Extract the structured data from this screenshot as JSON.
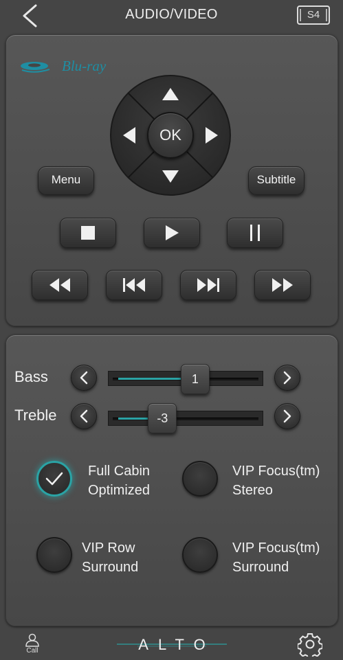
{
  "header": {
    "title": "AUDIO/VIDEO",
    "seat_badge": "S4",
    "back_icon": "chevron-left-icon"
  },
  "bluray": {
    "logo_text": "Blu-ray",
    "accent_color": "#1e8ea3"
  },
  "dpad": {
    "ok_label": "OK"
  },
  "buttons": {
    "menu_label": "Menu",
    "subtitle_label": "Subtitle"
  },
  "transport": {
    "row1": [
      "stop-icon",
      "play-icon",
      "pause-icon"
    ],
    "row2": [
      "rewind-icon",
      "previous-track-icon",
      "next-track-icon",
      "fast-forward-icon"
    ]
  },
  "audio": {
    "bass": {
      "label": "Bass",
      "value": "1",
      "level": 0.57
    },
    "treble": {
      "label": "Treble",
      "value": "-3",
      "level": 0.33
    },
    "accent_color": "#2aa3a5"
  },
  "modes": [
    {
      "line1": "Full Cabin",
      "line2": "Optimized",
      "selected": true
    },
    {
      "line1": "VIP Focus(tm)",
      "line2": "Stereo",
      "selected": false
    },
    {
      "line1": "VIP Row",
      "line2": "Surround",
      "selected": false
    },
    {
      "line1": "VIP Focus(tm)",
      "line2": "Surround",
      "selected": false
    }
  ],
  "footer": {
    "call_label": "Call",
    "brand": "ALTO",
    "settings_icon": "gear-icon"
  }
}
